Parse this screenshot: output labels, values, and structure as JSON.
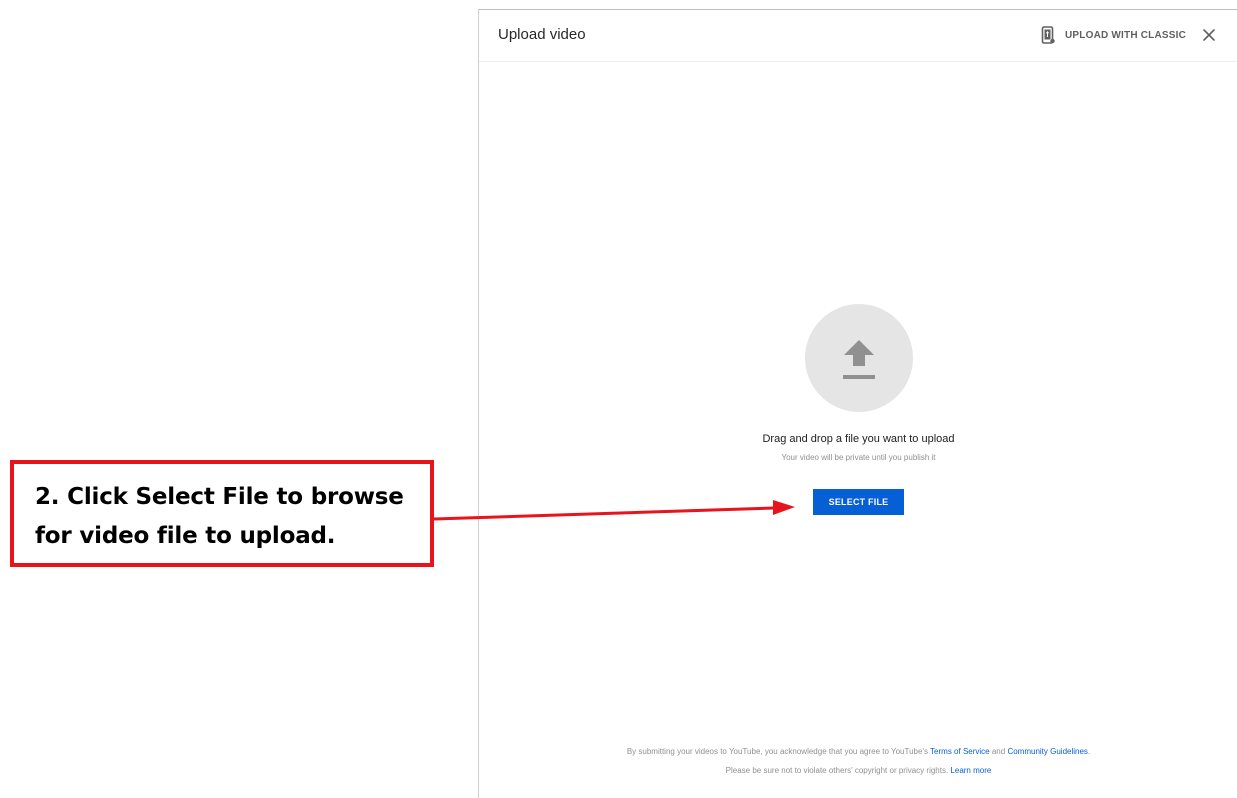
{
  "callout": {
    "line1": "2. Click Select File to browse",
    "line2": "for video file to upload.",
    "border_color": "#e8141b",
    "arrow_color": "#e8141b"
  },
  "dialog": {
    "title": "Upload video",
    "classic_label": "UPLOAD WITH CLASSIC",
    "classic_icon": "phone-upload-icon",
    "close_icon": "close-icon",
    "upload_icon": "upload-arrow-icon",
    "drag_text": "Drag and drop a file you want to upload",
    "private_text": "Your video will be private until you publish it",
    "select_label": "SELECT FILE",
    "accent_color": "#065fd4"
  },
  "footer": {
    "line1_prefix": "By submitting your videos to YouTube, you acknowledge that you agree to YouTube's",
    "terms_link": "Terms of Service",
    "and_text": "and",
    "guidelines_link": "Community Guidelines",
    "line1_suffix": ".",
    "line2_text": "Please be sure not to violate others' copyright or privacy rights.",
    "learn_more_link": "Learn more"
  }
}
